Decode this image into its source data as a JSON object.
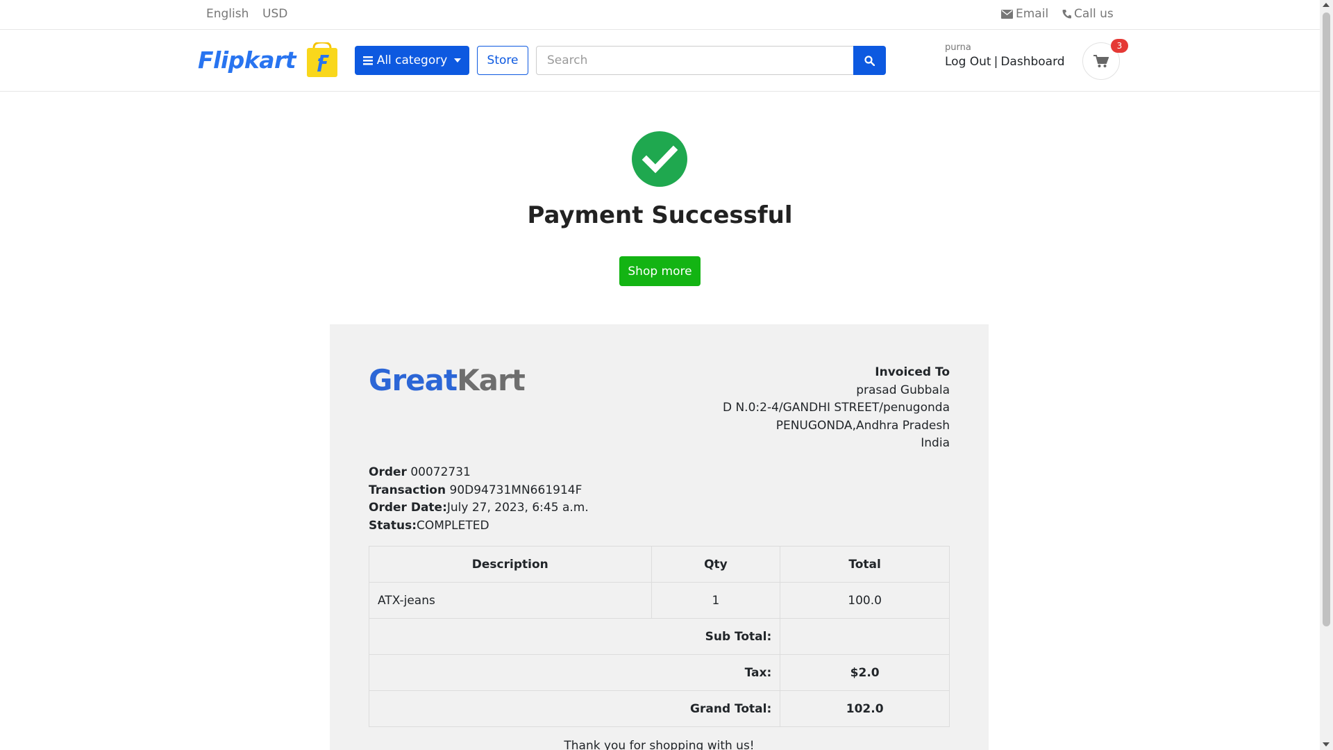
{
  "topbar": {
    "language": "English",
    "currency": "USD",
    "email_label": "Email",
    "call_label": "Call us"
  },
  "header": {
    "logo_text": "Flipkart",
    "all_category_label": "All category",
    "store_label": "Store",
    "search_placeholder": "Search",
    "username": "purna",
    "logout_label": "Log Out",
    "separator": "|",
    "dashboard_label": "Dashboard",
    "cart_count": "3"
  },
  "success": {
    "title": "Payment Successful",
    "shop_more_label": "Shop more"
  },
  "invoice": {
    "logo_great": "Great",
    "logo_kart": "Kart",
    "invoiced_to_label": "Invoiced To",
    "customer_name": "prasad Gubbala",
    "address_line1": "D N.0:2-4/GANDHI STREET/penugonda",
    "address_line2": "PENUGONDA,Andhra Pradesh",
    "country": "India",
    "order_label": "Order",
    "order_number": "00072731",
    "transaction_label": "Transaction",
    "transaction_id": "90D94731MN661914F",
    "order_date_label": "Order Date:",
    "order_date": "July 27, 2023, 6:45 a.m.",
    "status_label": "Status:",
    "status": "COMPLETED",
    "columns": [
      "Description",
      "Qty",
      "Total"
    ],
    "items": [
      {
        "description": "ATX-jeans",
        "qty": "1",
        "total": "100.0"
      }
    ],
    "sub_total_label": "Sub Total:",
    "sub_total_value": "",
    "tax_label": "Tax:",
    "tax_value": "$2.0",
    "grand_total_label": "Grand Total:",
    "grand_total_value": "102.0",
    "thanks": "Thank you for shopping with us!"
  },
  "colors": {
    "primary": "#0d59e0",
    "success": "#13b413",
    "check": "#1fa84f",
    "badge": "#e53935",
    "invoice_bg": "#f1f1f1"
  }
}
